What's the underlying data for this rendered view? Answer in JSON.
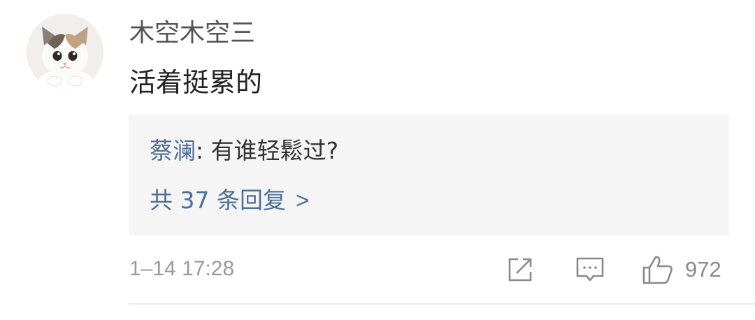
{
  "comment": {
    "username": "木空木空三",
    "text": "活着挺累的",
    "avatar": "cat-avatar",
    "timestamp": "1–14 17:28",
    "like_count": "972"
  },
  "reply_preview": {
    "author": "蔡澜",
    "separator": ":",
    "text": "有谁轻鬆过?",
    "view_all": "共 37 条回复",
    "view_all_chevron": ">"
  },
  "actions": {
    "icons": [
      "share-icon",
      "reply-comment-icon",
      "like-thumb-icon"
    ]
  },
  "colors": {
    "username": "#555555",
    "link_blue": "#4e6e98",
    "meta_gray": "#9a9a9a",
    "reply_bg": "#f5f5f5"
  }
}
